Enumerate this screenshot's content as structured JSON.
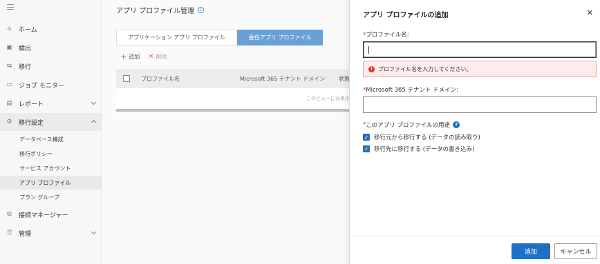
{
  "sidebar": {
    "items": [
      {
        "label": "ホーム",
        "icon": "home-icon"
      },
      {
        "label": "検出",
        "icon": "discover-icon"
      },
      {
        "label": "移行",
        "icon": "migrate-icon"
      },
      {
        "label": "ジョブ モニター",
        "icon": "monitor-icon"
      },
      {
        "label": "レポート",
        "icon": "report-icon"
      },
      {
        "label": "移行設定",
        "icon": "settings-icon"
      }
    ],
    "sub_items": [
      "データベース構成",
      "移行ポリシー",
      "サービス アカウント",
      "アプリ プロファイル",
      "プラン グループ"
    ],
    "bottom_items": [
      {
        "label": "接続マネージャー",
        "icon": "connection-icon"
      },
      {
        "label": "管理",
        "icon": "admin-icon"
      }
    ]
  },
  "main": {
    "title": "アプリ プロファイル管理",
    "tabs": [
      "アプリケーション アプリ プロファイル",
      "委任アプリ プロファイル"
    ],
    "add_label": "追加",
    "delete_label": "削除",
    "columns": [
      "プロファイル名",
      "Microsoft 365 テナント ドメイン",
      "状態"
    ],
    "empty_text": "このビューには表示"
  },
  "panel": {
    "title": "アプリ プロファイルの追加",
    "profile_name_label": "プロファイル名:",
    "error_text": "プロファイル名を入力してください。",
    "tenant_label": "Microsoft 365 テナント ドメイン:",
    "usage_label": "このアプリ プロファイルの用途",
    "checks": [
      "移行元から移行する (データの読み取り)",
      "移行先に移行する (データの書き込み)"
    ],
    "ok_label": "追加",
    "cancel_label": "キャンセル"
  },
  "colors": {
    "primary": "#1f6fc5",
    "tab_active": "#6aa0d6",
    "error": "#d9342b"
  }
}
